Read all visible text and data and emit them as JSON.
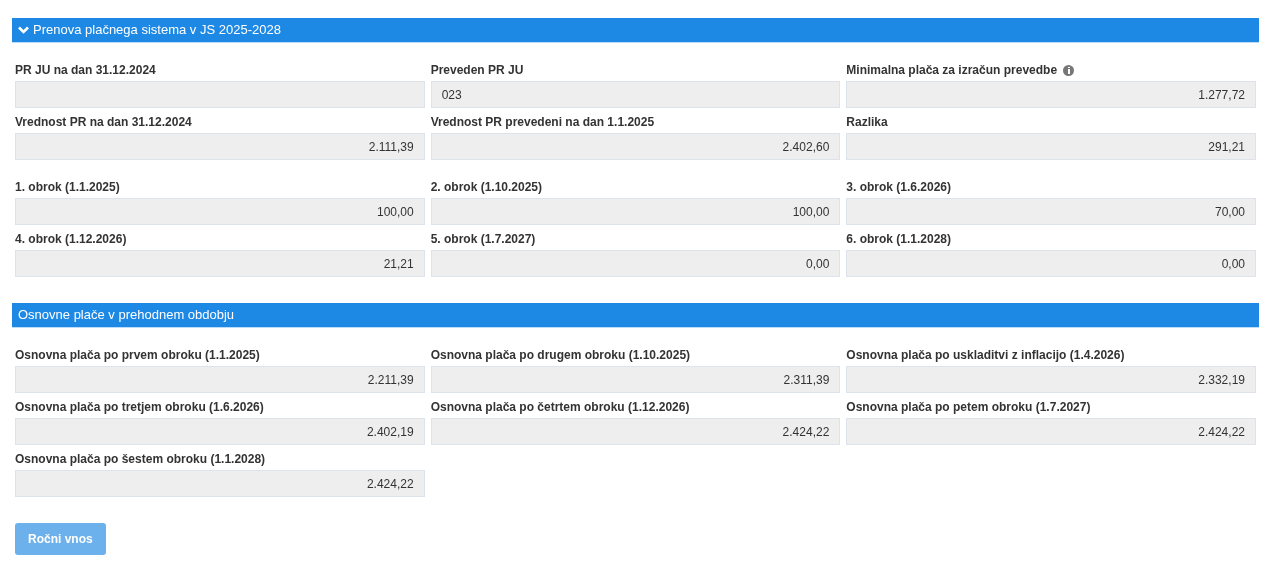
{
  "sections": [
    {
      "title": "Prenova plačnega sistema v JS 2025-2028",
      "expanded": true,
      "groups": [
        [
          {
            "label": "PR JU na dan 31.12.2024",
            "kind": "number"
          },
          {
            "label": "Preveden PR JU",
            "value": "023",
            "kind": "text"
          },
          {
            "label": "Minimalna plača za izračun prevedbe",
            "value": "1.277,72",
            "kind": "number",
            "info": true
          },
          {
            "label": "Vrednost PR na dan 31.12.2024",
            "value": "2.111,39",
            "kind": "number"
          },
          {
            "label": "Vrednost PR prevedeni na dan 1.1.2025",
            "value": "2.402,60",
            "kind": "number"
          },
          {
            "label": "Razlika",
            "value": "291,21",
            "kind": "number"
          }
        ],
        [
          {
            "label": "1. obrok (1.1.2025)",
            "value": "100,00",
            "kind": "number"
          },
          {
            "label": "2. obrok (1.10.2025)",
            "value": "100,00",
            "kind": "number"
          },
          {
            "label": "3. obrok (1.6.2026)",
            "value": "70,00",
            "kind": "number"
          },
          {
            "label": "4. obrok (1.12.2026)",
            "value": "21,21",
            "kind": "number"
          },
          {
            "label": "5. obrok (1.7.2027)",
            "value": "0,00",
            "kind": "number"
          },
          {
            "label": "6. obrok (1.1.2028)",
            "value": "0,00",
            "kind": "number"
          }
        ]
      ]
    },
    {
      "title": "Osnovne plače v prehodnem obdobju",
      "groups": [
        [
          {
            "label": "Osnovna plača po prvem obroku (1.1.2025)",
            "value": "2.211,39",
            "kind": "number"
          },
          {
            "label": "Osnovna plača po drugem obroku (1.10.2025)",
            "value": "2.311,39",
            "kind": "number"
          },
          {
            "label": "Osnovna plača po uskladitvi z inflacijo (1.4.2026)",
            "value": "2.332,19",
            "kind": "number"
          },
          {
            "label": "Osnovna plača po tretjem obroku (1.6.2026)",
            "value": "2.402,19",
            "kind": "number"
          },
          {
            "label": "Osnovna plača po četrtem obroku (1.12.2026)",
            "value": "2.424,22",
            "kind": "number"
          },
          {
            "label": "Osnovna plača po petem obroku (1.7.2027)",
            "value": "2.424,22",
            "kind": "number"
          },
          {
            "label": "Osnovna plača po šestem obroku (1.1.2028)",
            "value": "2.424,22",
            "kind": "number"
          }
        ]
      ]
    }
  ],
  "button": {
    "label": "Ročni vnos",
    "disabled": true
  }
}
